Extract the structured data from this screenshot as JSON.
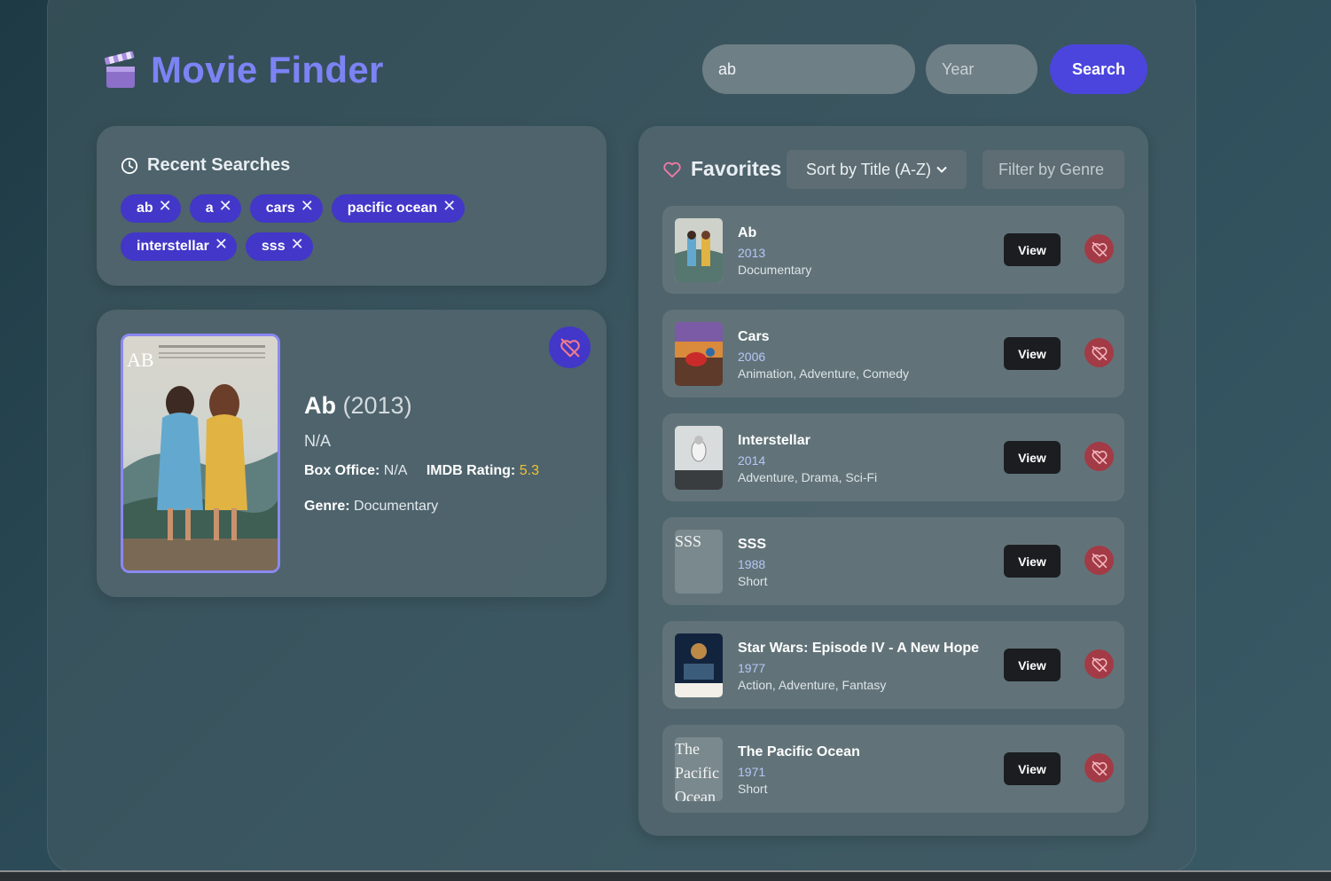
{
  "header": {
    "title": "Movie Finder",
    "icon": "clapperboard-icon",
    "search_value": "ab",
    "year_placeholder": "Year",
    "search_label": "Search"
  },
  "recent": {
    "title": "Recent Searches",
    "icon": "clock-icon",
    "chips": [
      "ab",
      "a",
      "cars",
      "pacific ocean",
      "interstellar",
      "sss"
    ],
    "remove_glyph": "✕"
  },
  "detail": {
    "title": "Ab",
    "year": "(2013)",
    "rated": "N/A",
    "box_office_label": "Box Office:",
    "box_office": "N/A",
    "imdb_label": "IMDB Rating:",
    "imdb_rating": "5.3",
    "genre_label": "Genre:",
    "genre": "Documentary",
    "poster_text": "AB"
  },
  "favorites": {
    "title": "Favorites",
    "icon": "heart-icon",
    "sort_value": "Sort by Title (A-Z)",
    "genre_placeholder": "Filter by Genre",
    "view_label": "View",
    "items": [
      {
        "title": "Ab",
        "year": "2013",
        "genre": "Documentary"
      },
      {
        "title": "Cars",
        "year": "2006",
        "genre": "Animation, Adventure, Comedy"
      },
      {
        "title": "Interstellar",
        "year": "2014",
        "genre": "Adventure, Drama, Sci-Fi"
      },
      {
        "title": "SSS",
        "year": "1988",
        "genre": "Short",
        "alt": "SSS"
      },
      {
        "title": "Star Wars: Episode IV - A New Hope",
        "year": "1977",
        "genre": "Action, Adventure, Fantasy"
      },
      {
        "title": "The Pacific Ocean",
        "year": "1971",
        "genre": "Short",
        "alt": "The Pacific Ocean"
      }
    ]
  },
  "colors": {
    "accent": "#4b45de",
    "brand": "#7b83f5",
    "chip": "#4237c8",
    "unfavorite": "#a23b46",
    "rating": "#f1c232"
  }
}
